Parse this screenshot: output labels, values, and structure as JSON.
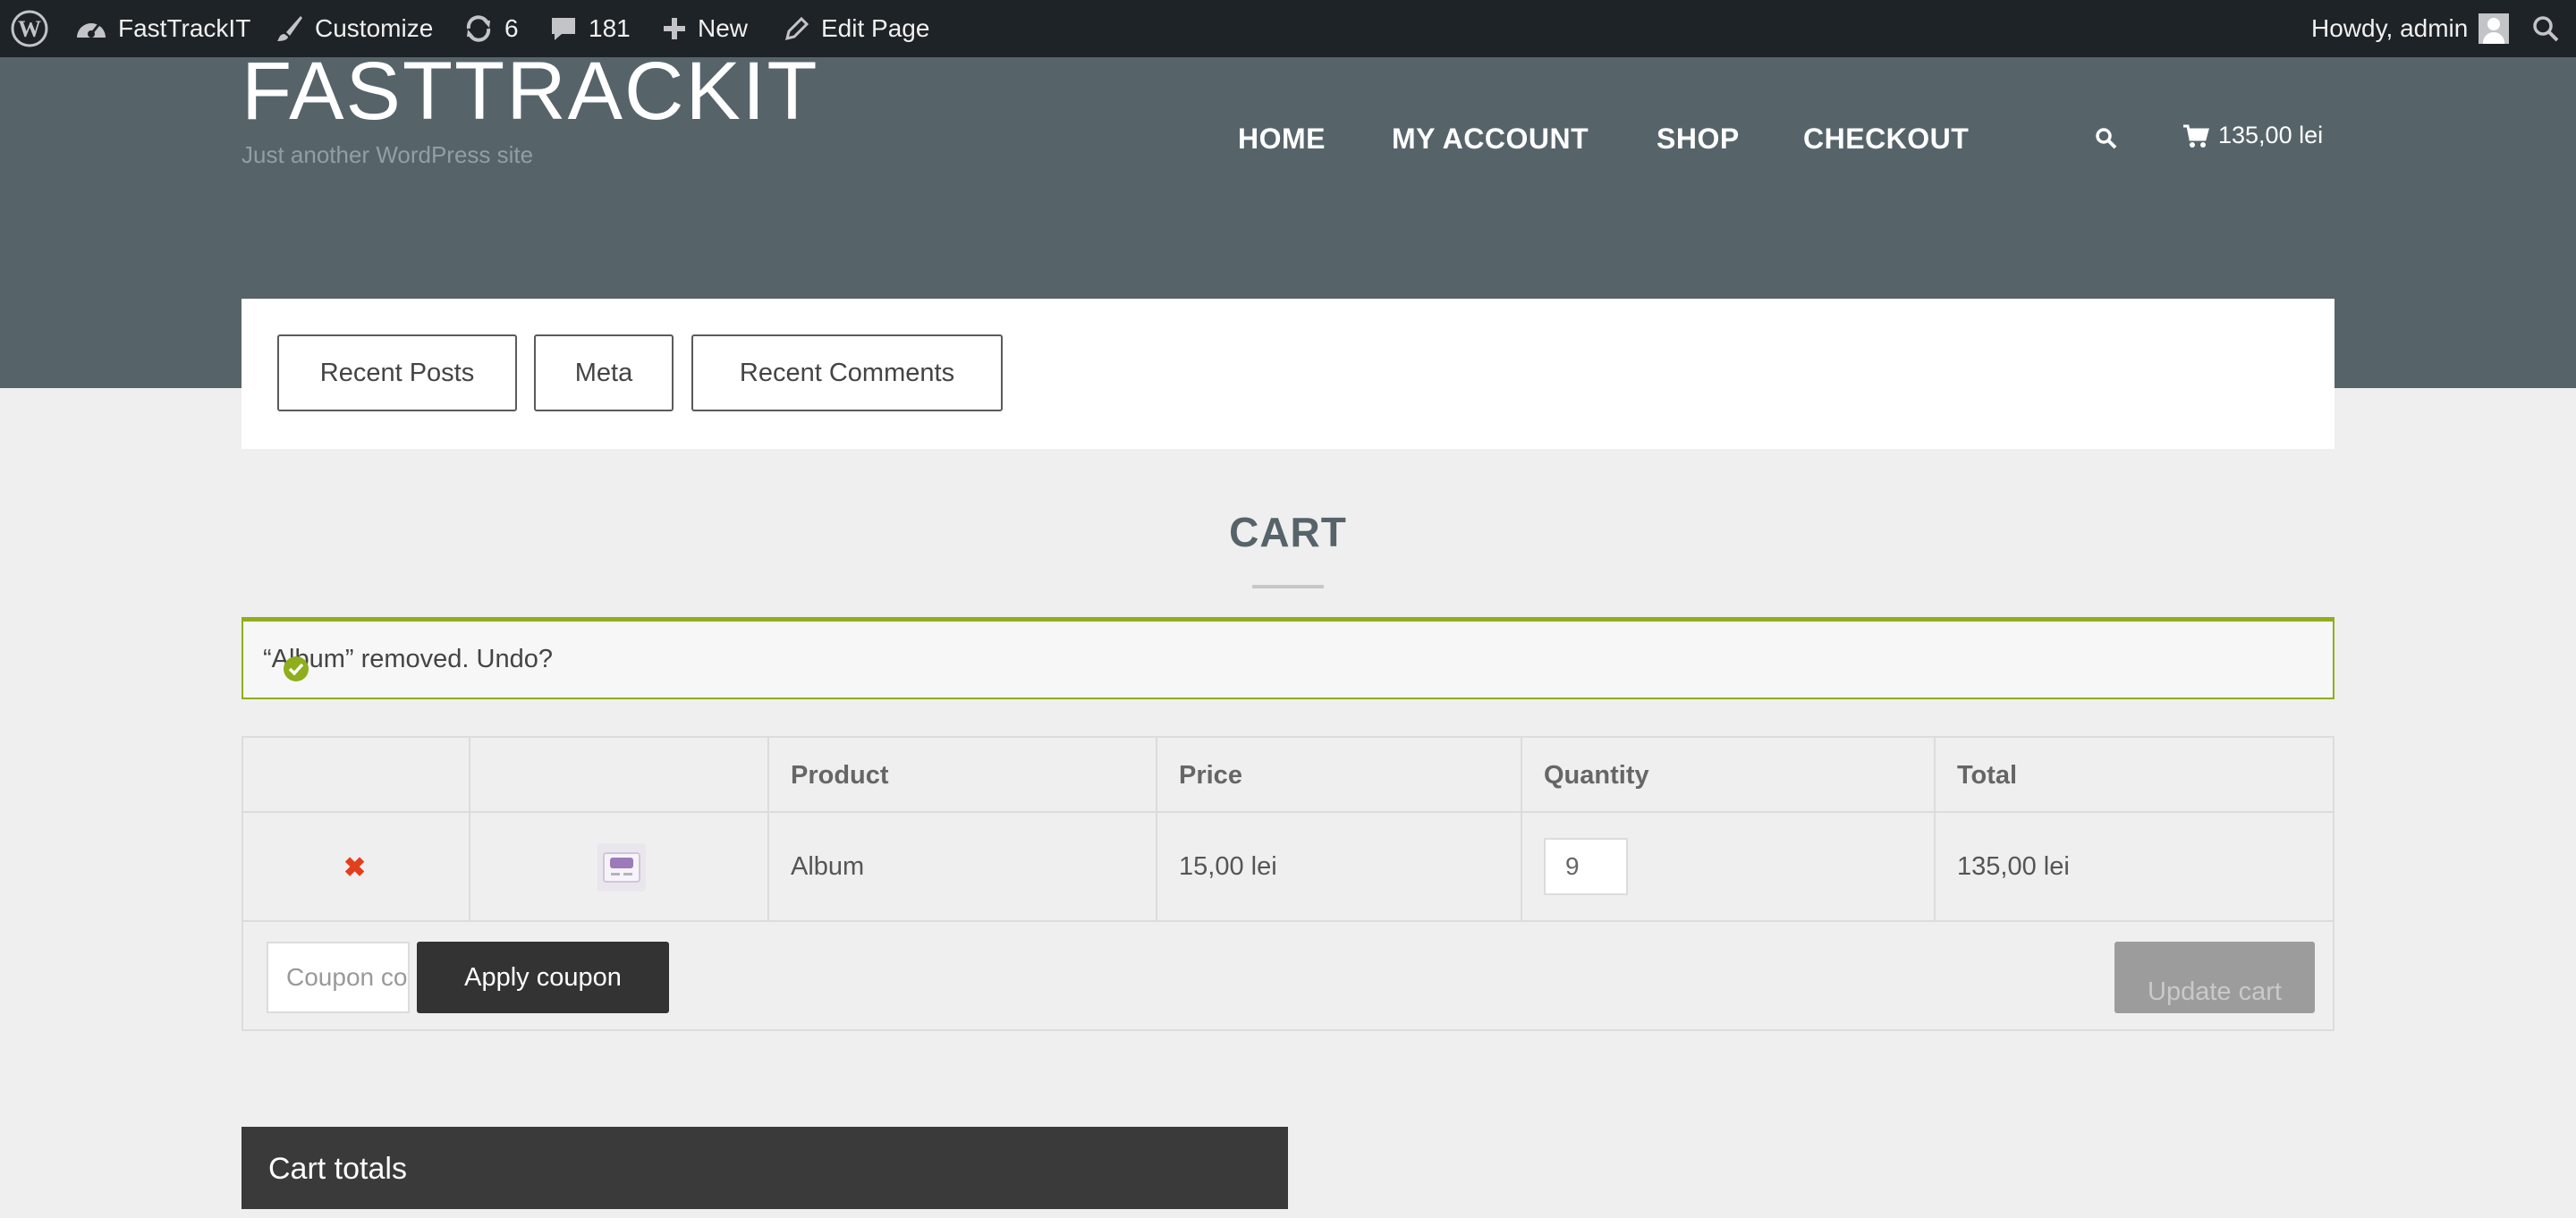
{
  "adminbar": {
    "site_name": "FastTrackIT",
    "customize": "Customize",
    "updates_count": "6",
    "comments_count": "181",
    "new_label": "New",
    "edit_page": "Edit Page",
    "greeting": "Howdy, admin"
  },
  "header": {
    "site_title": "FASTTRACKIT",
    "tagline": "Just another WordPress site",
    "nav": [
      "HOME",
      "MY ACCOUNT",
      "SHOP",
      "CHECKOUT"
    ],
    "cart_total": "135,00 lei"
  },
  "widgets": [
    "Recent Posts",
    "Meta",
    "Recent Comments"
  ],
  "page": {
    "title": "CART",
    "notice": "“Album” removed. Undo?"
  },
  "cart_table": {
    "headers": {
      "product": "Product",
      "price": "Price",
      "quantity": "Quantity",
      "total": "Total"
    },
    "rows": [
      {
        "remove": "✖",
        "product": "Album",
        "price": "15,00 lei",
        "quantity": "9",
        "total": "135,00 lei"
      }
    ],
    "coupon_placeholder": "Coupon code",
    "apply_coupon": "Apply coupon",
    "update_cart": "Update cart"
  },
  "cart_totals": {
    "title": "Cart totals"
  },
  "colors": {
    "adminbar": "#1d2327",
    "header": "#56646a",
    "notice_border": "#8fae1b",
    "remove": "#e2401c",
    "dark_button": "#333333"
  },
  "icons": [
    "wordpress-icon",
    "dashboard-icon",
    "brush-icon",
    "updates-icon",
    "comment-icon",
    "plus-icon",
    "pencil-icon",
    "avatar",
    "search-icon",
    "cart-icon",
    "check-circle-icon",
    "product-thumbnail"
  ]
}
